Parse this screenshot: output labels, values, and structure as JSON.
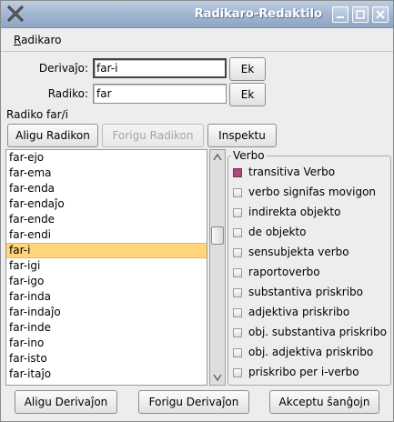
{
  "window": {
    "title": "Radikaro-Redaktilo"
  },
  "menu": {
    "radikaro_first": "R",
    "radikaro_rest": "adikaro"
  },
  "form": {
    "derivajo_label": "Derivaĵo:",
    "derivajo_value": "far-i",
    "radiko_label": "Radiko:",
    "radiko_value": "far",
    "ek_label": "Ek",
    "radiko_heading": "Radiko far/i"
  },
  "buttons": {
    "aligu_radikon": "Aligu Radikon",
    "forigu_radikon": "Forigu Radikon",
    "inspektu": "Inspektu",
    "aligu_derivajon": "Aligu Derivaĵon",
    "forigu_derivajon": "Forigu Derivaĵon",
    "akceptu": "Akceptu ŝanĝojn"
  },
  "derivations": [
    "far-ejo",
    "far-ema",
    "far-enda",
    "far-endaĵo",
    "far-ende",
    "far-endi",
    "far-i",
    "far-igi",
    "far-igo",
    "far-inda",
    "far-indaĵo",
    "far-inde",
    "far-ino",
    "far-isto",
    "far-itaĵo"
  ],
  "selected_derivation": "far-i",
  "verbo": {
    "title": "Verbo",
    "options": [
      {
        "label": "transitiva Verbo",
        "checked": true
      },
      {
        "label": "verbo signifas movigon",
        "checked": false
      },
      {
        "label": "indirekta objekto",
        "checked": false
      },
      {
        "label": "de objekto",
        "checked": false
      },
      {
        "label": "sensubjekta verbo",
        "checked": false
      },
      {
        "label": "raportoverbo",
        "checked": false
      },
      {
        "label": "substantiva priskribo",
        "checked": false
      },
      {
        "label": "adjektiva priskribo",
        "checked": false
      },
      {
        "label": "obj. substantiva priskribo",
        "checked": false
      },
      {
        "label": "obj. adjektiva priskribo",
        "checked": false
      },
      {
        "label": "priskribo per i-verbo",
        "checked": false
      }
    ]
  },
  "colors": {
    "selection": "#ffd77a",
    "checked": "#b1487a",
    "titlebar": "#9fb4cf"
  }
}
